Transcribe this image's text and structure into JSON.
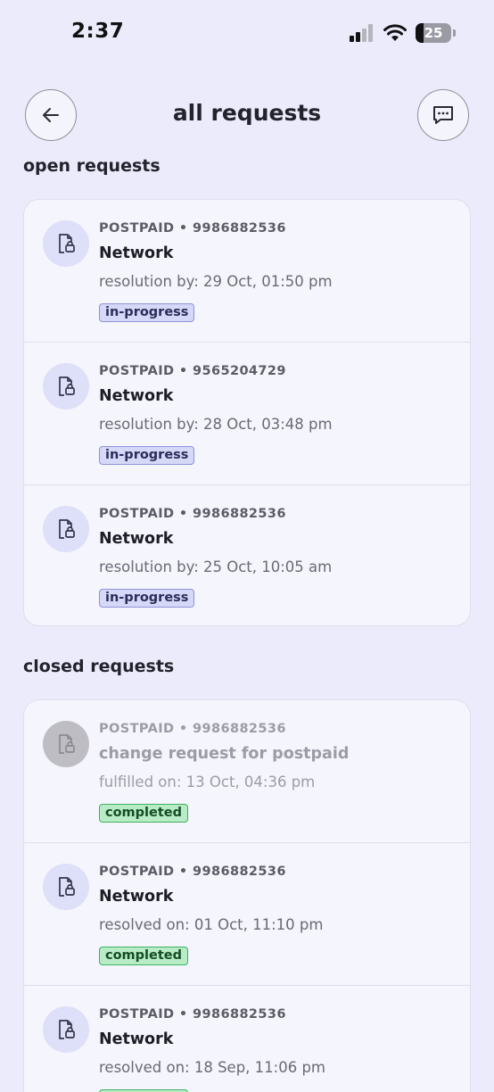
{
  "status_bar": {
    "time": "2:37",
    "battery": "25"
  },
  "header": {
    "title": "all requests"
  },
  "open": {
    "title": "open requests",
    "items": [
      {
        "meta": "POSTPAID • 9986882536",
        "title": "Network",
        "sub": "resolution by: 29 Oct, 01:50 pm",
        "badge": "in-progress"
      },
      {
        "meta": "POSTPAID • 9565204729",
        "title": "Network",
        "sub": "resolution by: 28 Oct, 03:48 pm",
        "badge": "in-progress"
      },
      {
        "meta": "POSTPAID • 9986882536",
        "title": "Network",
        "sub": "resolution by: 25 Oct, 10:05 am",
        "badge": "in-progress"
      }
    ]
  },
  "closed": {
    "title": "closed requests",
    "items": [
      {
        "meta": "POSTPAID • 9986882536",
        "title": "change request for postpaid",
        "sub": "fulfilled on: 13 Oct, 04:36 pm",
        "badge": "completed"
      },
      {
        "meta": "POSTPAID • 9986882536",
        "title": "Network",
        "sub": "resolved on: 01 Oct, 11:10 pm",
        "badge": "completed"
      },
      {
        "meta": "POSTPAID • 9986882536",
        "title": "Network",
        "sub": "resolved on: 18 Sep, 11:06 pm",
        "badge": "completed"
      }
    ]
  },
  "colors": {
    "background": "#ecebfb",
    "in_progress": "#d6d8f8",
    "completed": "#b8ecc6"
  },
  "icons": {
    "back": "arrow-left-icon",
    "chat": "message-icon",
    "request": "document-lock-icon"
  }
}
